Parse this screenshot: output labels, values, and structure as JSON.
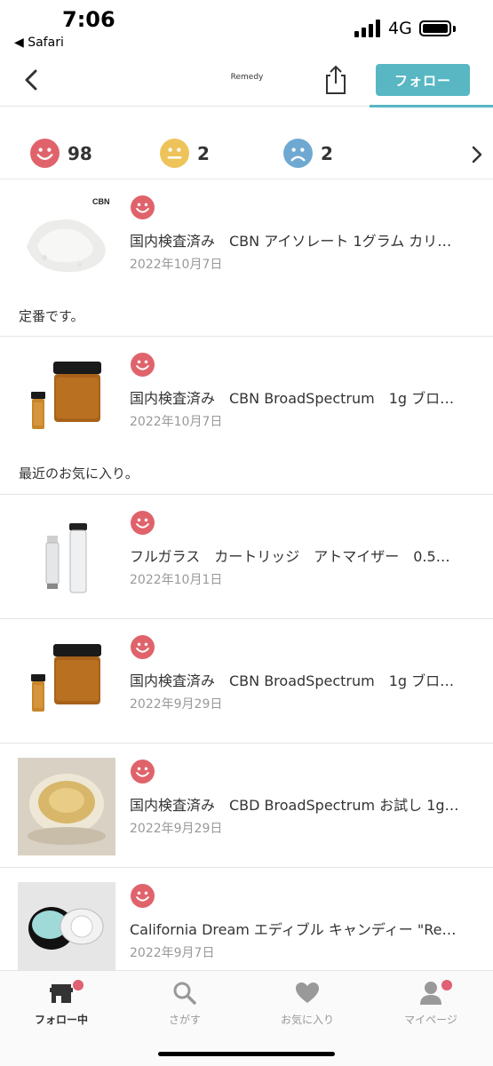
{
  "status_bar": {
    "time": "7:06",
    "back_app": "◀ Safari",
    "network": "4G"
  },
  "header": {
    "logo": "Remedy",
    "follow_label": "フォロー"
  },
  "ratings": [
    {
      "type": "good",
      "color": "#e0636b",
      "count": "98"
    },
    {
      "type": "neutral",
      "color": "#eec35a",
      "count": "2"
    },
    {
      "type": "bad",
      "color": "#6fa9d2",
      "count": "2"
    }
  ],
  "feed": [
    {
      "title": "国内検査済み　CBN アイソレート 1グラム カリ…",
      "date": "2022年10月7日",
      "comment": "定番です。",
      "thumb_label": "CBN"
    },
    {
      "title": "国内検査済み　CBN BroadSpectrum　1g ブロ…",
      "date": "2022年10月7日",
      "comment": "最近のお気に入り。"
    },
    {
      "title": "フルガラス　カートリッジ　アトマイザー　0.5…",
      "date": "2022年10月1日"
    },
    {
      "title": "国内検査済み　CBN BroadSpectrum　1g ブロ…",
      "date": "2022年9月29日"
    },
    {
      "title": "国内検査済み　CBD BroadSpectrum お試し 1g…",
      "date": "2022年9月29日"
    },
    {
      "title": "California Dream エディブル キャンディー \"Re…",
      "date": "2022年9月7日"
    }
  ],
  "tabs": [
    {
      "label": "フォロー中",
      "icon": "store-icon"
    },
    {
      "label": "さがす",
      "icon": "search-icon"
    },
    {
      "label": "お気に入り",
      "icon": "heart-icon"
    },
    {
      "label": "マイページ",
      "icon": "person-icon"
    }
  ],
  "colors": {
    "accent": "#58b7c3",
    "good": "#e0636b",
    "badge": "#e06074"
  }
}
